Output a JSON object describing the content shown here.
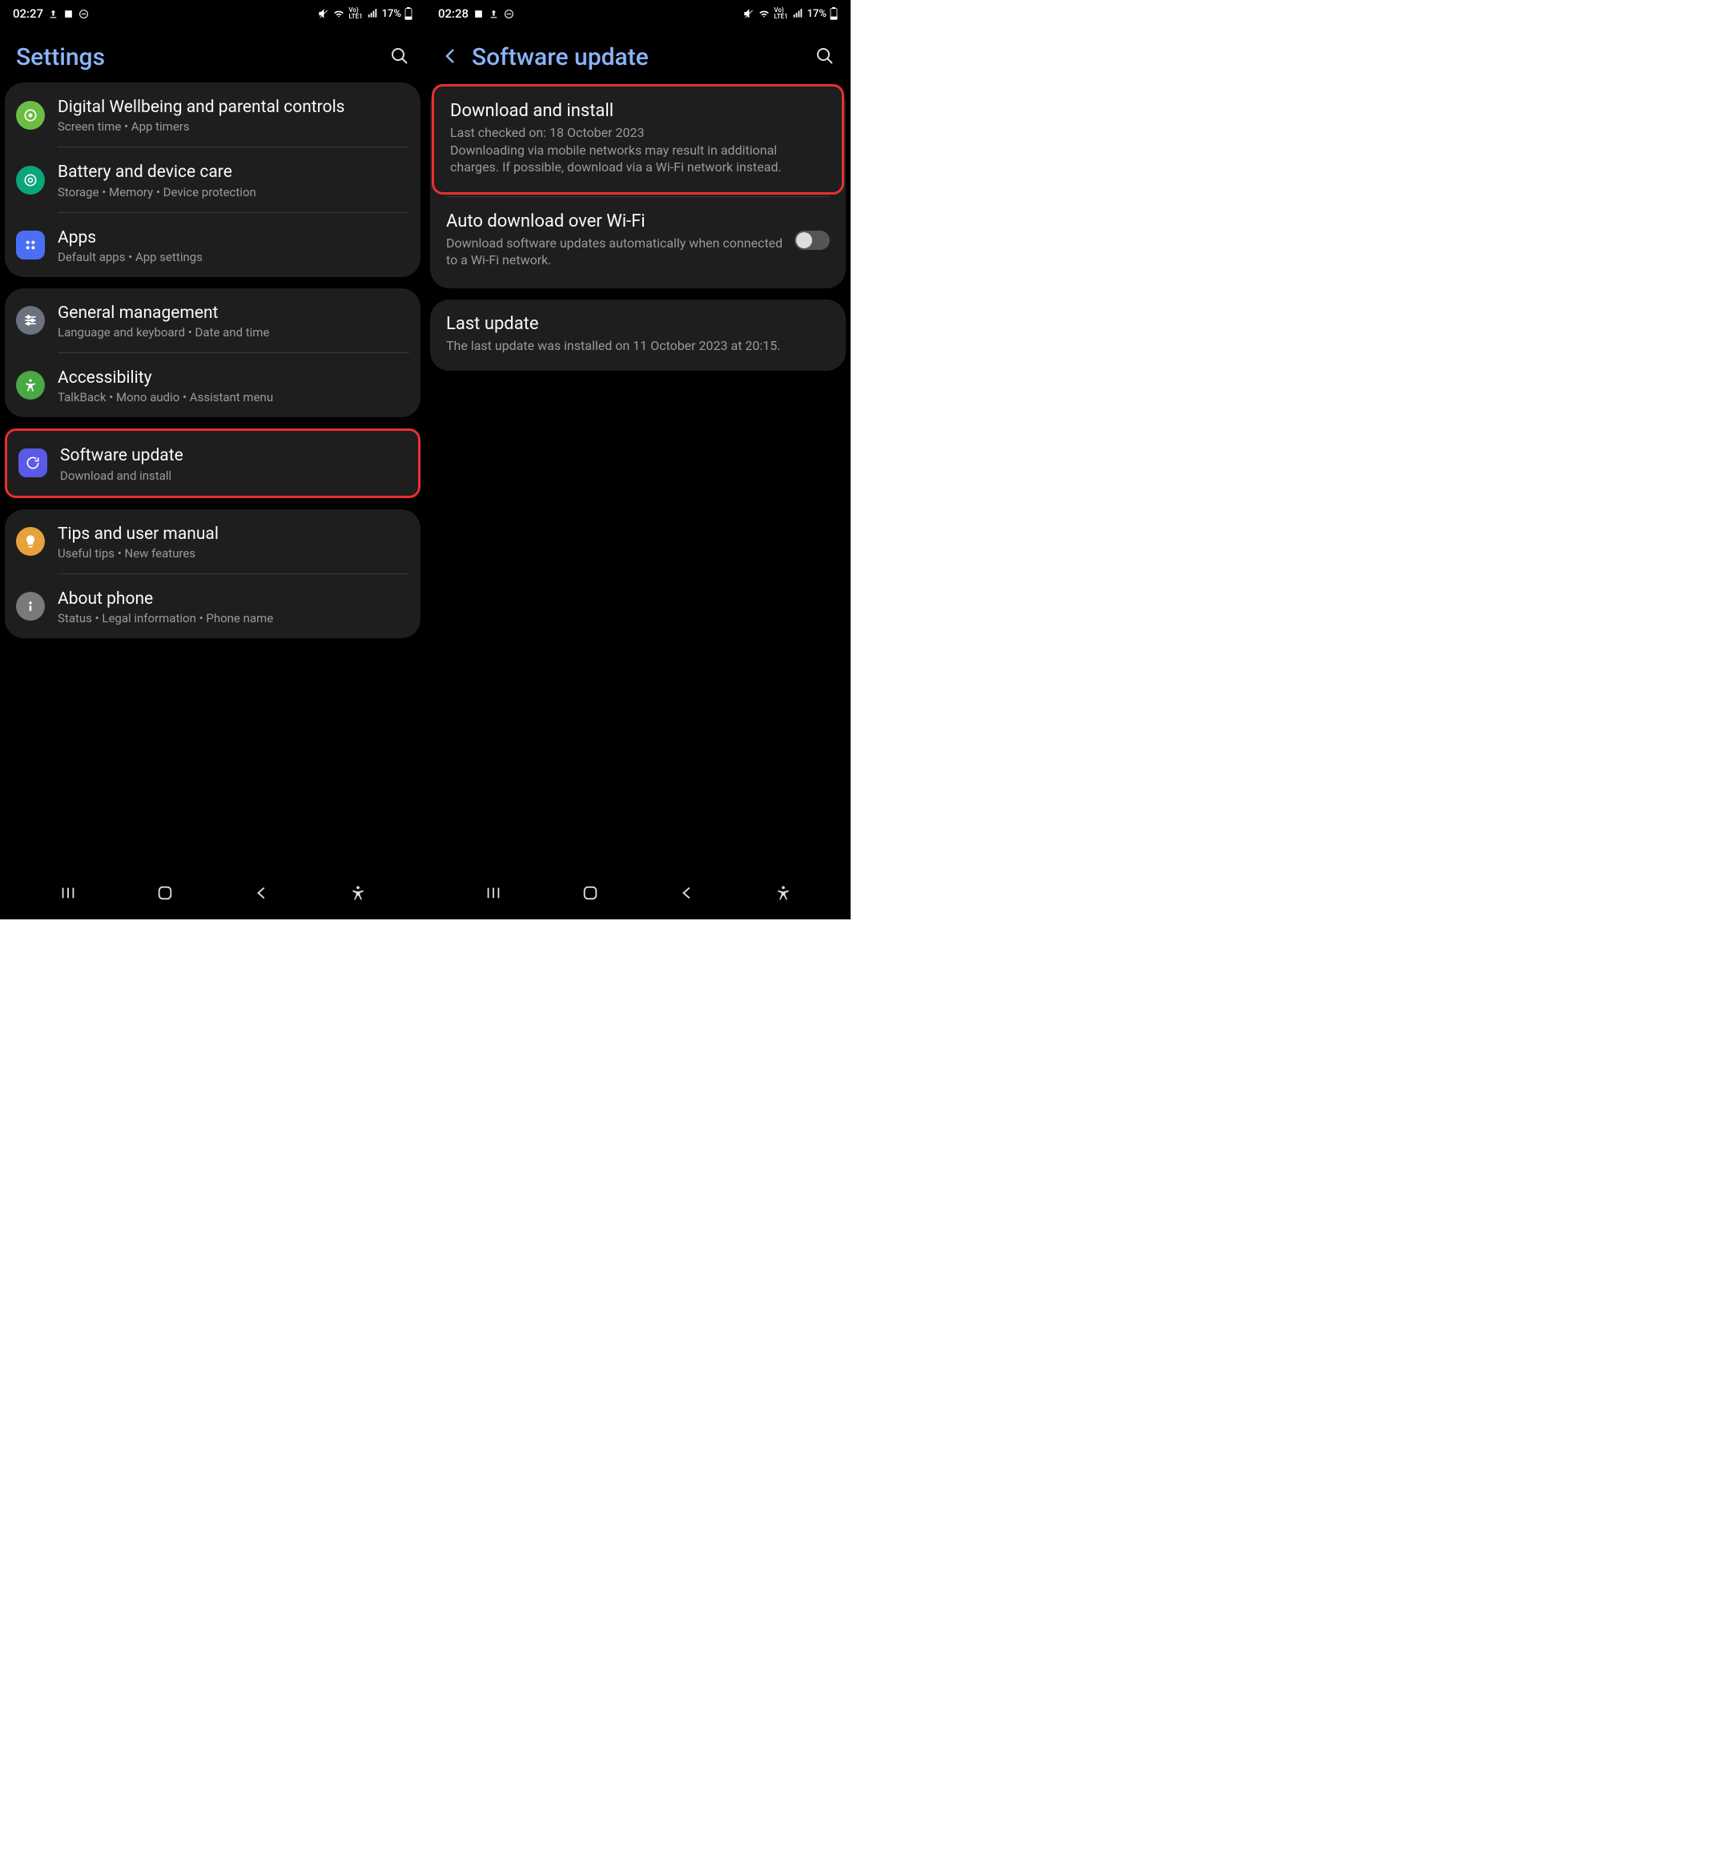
{
  "screen1": {
    "status": {
      "time": "02:27",
      "battery": "17%"
    },
    "header": {
      "title": "Settings"
    },
    "groups": [
      {
        "items": [
          {
            "title": "Digital Wellbeing and parental controls",
            "sub": "Screen time  •  App timers",
            "icon": "wellbeing",
            "color": "#6bbd45"
          },
          {
            "title": "Battery and device care",
            "sub": "Storage  •  Memory  •  Device protection",
            "icon": "care",
            "color": "#0aa67b"
          },
          {
            "title": "Apps",
            "sub": "Default apps  •  App settings",
            "icon": "apps",
            "color": "#4a6ff5"
          }
        ]
      },
      {
        "items": [
          {
            "title": "General management",
            "sub": "Language and keyboard  •  Date and time",
            "icon": "sliders",
            "color": "#6b7380"
          },
          {
            "title": "Accessibility",
            "sub": "TalkBack  •  Mono audio  •  Assistant menu",
            "icon": "a11y",
            "color": "#4aa845"
          }
        ]
      },
      {
        "highlighted": true,
        "items": [
          {
            "title": "Software update",
            "sub": "Download and install",
            "icon": "update",
            "color": "#5a5ae8"
          }
        ]
      },
      {
        "items": [
          {
            "title": "Tips and user manual",
            "sub": "Useful tips  •  New features",
            "icon": "bulb",
            "color": "#e8a23a"
          },
          {
            "title": "About phone",
            "sub": "Status  •  Legal information  •  Phone name",
            "icon": "info",
            "color": "#7a7a7a"
          }
        ]
      }
    ]
  },
  "screen2": {
    "status": {
      "time": "02:28",
      "battery": "17%"
    },
    "header": {
      "title": "Software update"
    },
    "block1": {
      "download": {
        "title": "Download and install",
        "sub": "Last checked on: 18 October 2023\nDownloading via mobile networks may result in additional charges. If possible, download via a Wi-Fi network instead.",
        "highlighted": true
      },
      "auto": {
        "title": "Auto download over Wi-Fi",
        "sub": "Download software updates automatically when connected to a Wi-Fi network.",
        "toggle": false
      }
    },
    "block2": {
      "last": {
        "title": "Last update",
        "sub": "The last update was installed on 11 October 2023 at 20:15."
      }
    }
  }
}
